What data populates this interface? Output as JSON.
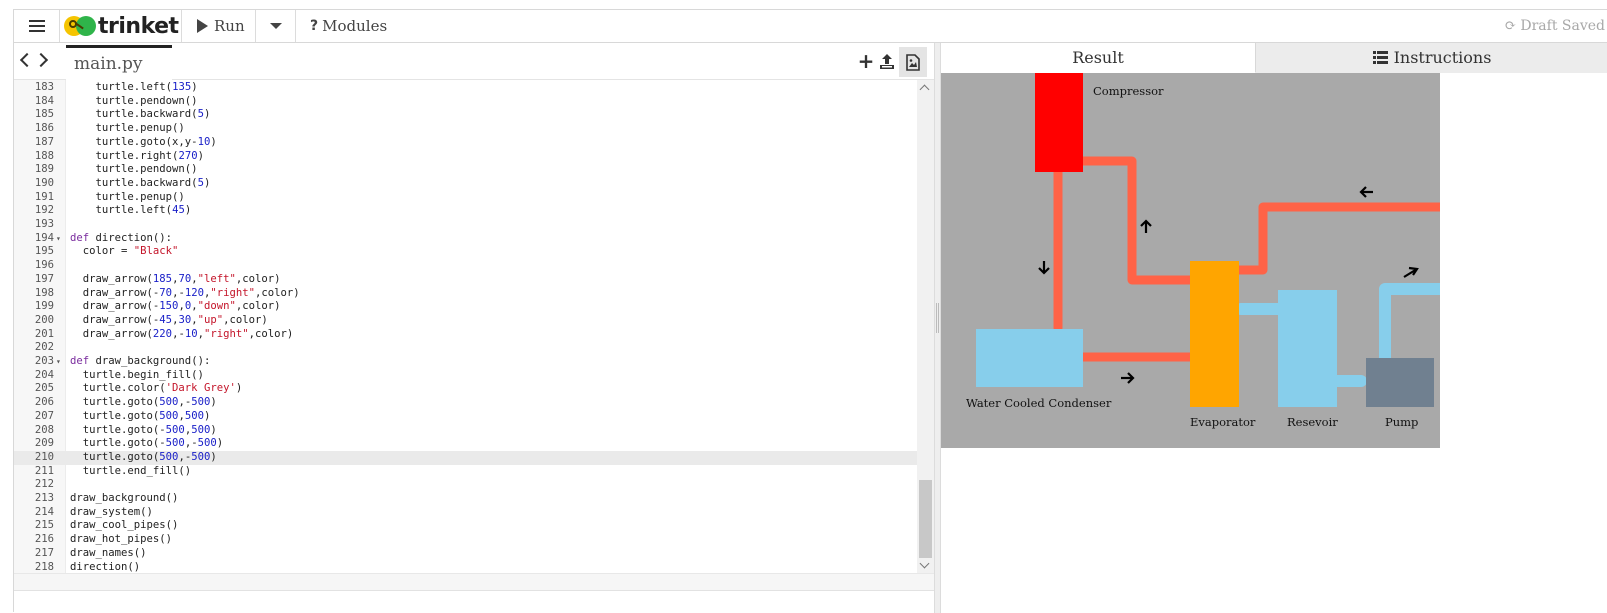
{
  "topbar": {
    "logo_text": "trinket",
    "run_label": "Run",
    "modules_label": "Modules",
    "status": "Draft Saved"
  },
  "editor": {
    "file_name": "main.py",
    "lines": [
      {
        "n": "183",
        "code": "    turtle.left(135)",
        "tokens": [
          [
            "    turtle.left(",
            ""
          ],
          [
            "135",
            "num"
          ],
          [
            ")",
            ""
          ]
        ]
      },
      {
        "n": "184",
        "tokens": [
          [
            "    turtle.pendown()",
            ""
          ]
        ]
      },
      {
        "n": "185",
        "tokens": [
          [
            "    turtle.backward(",
            ""
          ],
          [
            "5",
            "num"
          ],
          [
            ")",
            ""
          ]
        ]
      },
      {
        "n": "186",
        "tokens": [
          [
            "    turtle.penup()",
            ""
          ]
        ]
      },
      {
        "n": "187",
        "tokens": [
          [
            "    turtle.goto(x,y-",
            ""
          ],
          [
            "10",
            "num"
          ],
          [
            ")",
            ""
          ]
        ]
      },
      {
        "n": "188",
        "tokens": [
          [
            "    turtle.right(",
            ""
          ],
          [
            "270",
            "num"
          ],
          [
            ")",
            ""
          ]
        ]
      },
      {
        "n": "189",
        "tokens": [
          [
            "    turtle.pendown()",
            ""
          ]
        ]
      },
      {
        "n": "190",
        "tokens": [
          [
            "    turtle.backward(",
            ""
          ],
          [
            "5",
            "num"
          ],
          [
            ")",
            ""
          ]
        ]
      },
      {
        "n": "191",
        "tokens": [
          [
            "    turtle.penup()",
            ""
          ]
        ]
      },
      {
        "n": "192",
        "tokens": [
          [
            "    turtle.left(",
            ""
          ],
          [
            "45",
            "num"
          ],
          [
            ")",
            ""
          ]
        ]
      },
      {
        "n": "193",
        "tokens": []
      },
      {
        "n": "194",
        "fold": true,
        "tokens": [
          [
            "def",
            "kw"
          ],
          [
            " direction():",
            ""
          ]
        ]
      },
      {
        "n": "195",
        "tokens": [
          [
            "  color = ",
            ""
          ],
          [
            "\"Black\"",
            "str"
          ]
        ]
      },
      {
        "n": "196",
        "tokens": []
      },
      {
        "n": "197",
        "tokens": [
          [
            "  draw_arrow(",
            ""
          ],
          [
            "185",
            "num"
          ],
          [
            ",",
            ""
          ],
          [
            "70",
            "num"
          ],
          [
            ",",
            ""
          ],
          [
            "\"left\"",
            "str"
          ],
          [
            ",color)",
            ""
          ]
        ]
      },
      {
        "n": "198",
        "tokens": [
          [
            "  draw_arrow(-",
            ""
          ],
          [
            "70",
            "num"
          ],
          [
            ",-",
            ""
          ],
          [
            "120",
            "num"
          ],
          [
            ",",
            ""
          ],
          [
            "\"right\"",
            "str"
          ],
          [
            ",color)",
            ""
          ]
        ]
      },
      {
        "n": "199",
        "tokens": [
          [
            "  draw_arrow(-",
            ""
          ],
          [
            "150",
            "num"
          ],
          [
            ",",
            ""
          ],
          [
            "0",
            "num"
          ],
          [
            ",",
            ""
          ],
          [
            "\"down\"",
            "str"
          ],
          [
            ",color)",
            ""
          ]
        ]
      },
      {
        "n": "200",
        "tokens": [
          [
            "  draw_arrow(-",
            ""
          ],
          [
            "45",
            "num"
          ],
          [
            ",",
            ""
          ],
          [
            "30",
            "num"
          ],
          [
            ",",
            ""
          ],
          [
            "\"up\"",
            "str"
          ],
          [
            ",color)",
            ""
          ]
        ]
      },
      {
        "n": "201",
        "tokens": [
          [
            "  draw_arrow(",
            ""
          ],
          [
            "220",
            "num"
          ],
          [
            ",-",
            ""
          ],
          [
            "10",
            "num"
          ],
          [
            ",",
            ""
          ],
          [
            "\"right\"",
            "str"
          ],
          [
            ",color)",
            ""
          ]
        ]
      },
      {
        "n": "202",
        "tokens": []
      },
      {
        "n": "203",
        "fold": true,
        "tokens": [
          [
            "def",
            "kw"
          ],
          [
            " draw_background():",
            ""
          ]
        ]
      },
      {
        "n": "204",
        "tokens": [
          [
            "  turtle.begin_fill()",
            ""
          ]
        ]
      },
      {
        "n": "205",
        "tokens": [
          [
            "  turtle.color(",
            ""
          ],
          [
            "'Dark Grey'",
            "str"
          ],
          [
            ")",
            ""
          ]
        ]
      },
      {
        "n": "206",
        "tokens": [
          [
            "  turtle.goto(",
            ""
          ],
          [
            "500",
            "num"
          ],
          [
            ",-",
            ""
          ],
          [
            "500",
            "num"
          ],
          [
            ")",
            ""
          ]
        ]
      },
      {
        "n": "207",
        "tokens": [
          [
            "  turtle.goto(",
            ""
          ],
          [
            "500",
            "num"
          ],
          [
            ",",
            ""
          ],
          [
            "500",
            "num"
          ],
          [
            ")",
            ""
          ]
        ]
      },
      {
        "n": "208",
        "tokens": [
          [
            "  turtle.goto(-",
            ""
          ],
          [
            "500",
            "num"
          ],
          [
            ",",
            ""
          ],
          [
            "500",
            "num"
          ],
          [
            ")",
            ""
          ]
        ]
      },
      {
        "n": "209",
        "tokens": [
          [
            "  turtle.goto(-",
            ""
          ],
          [
            "500",
            "num"
          ],
          [
            ",-",
            ""
          ],
          [
            "500",
            "num"
          ],
          [
            ")",
            ""
          ]
        ]
      },
      {
        "n": "210",
        "active": true,
        "tokens": [
          [
            "  turtle.goto(",
            ""
          ],
          [
            "500",
            "num"
          ],
          [
            ",-",
            ""
          ],
          [
            "500",
            "num"
          ],
          [
            ")",
            ""
          ]
        ]
      },
      {
        "n": "211",
        "tokens": [
          [
            "  turtle.end_fill()",
            ""
          ]
        ]
      },
      {
        "n": "212",
        "tokens": []
      },
      {
        "n": "213",
        "tokens": [
          [
            "draw_background()",
            ""
          ]
        ]
      },
      {
        "n": "214",
        "tokens": [
          [
            "draw_system()",
            ""
          ]
        ]
      },
      {
        "n": "215",
        "tokens": [
          [
            "draw_cool_pipes()",
            ""
          ]
        ]
      },
      {
        "n": "216",
        "tokens": [
          [
            "draw_hot_pipes()",
            ""
          ]
        ]
      },
      {
        "n": "217",
        "tokens": [
          [
            "draw_names()",
            ""
          ]
        ]
      },
      {
        "n": "218",
        "tokens": [
          [
            "direction()",
            ""
          ]
        ]
      }
    ]
  },
  "output": {
    "tab_result": "Result",
    "tab_instructions": "Instructions",
    "labels": {
      "compressor": "Compressor",
      "condenser": "Water Cooled Condenser",
      "evaporator": "Evaporator",
      "resevoir": "Resevoir",
      "pump": "Pump"
    },
    "colors": {
      "background": "#a9a9a9",
      "compressor": "#ff0000",
      "hot_pipe": "#ff6347",
      "cool_pipe": "#87ceeb",
      "evaporator": "#ffa500",
      "pump": "#708090"
    }
  }
}
